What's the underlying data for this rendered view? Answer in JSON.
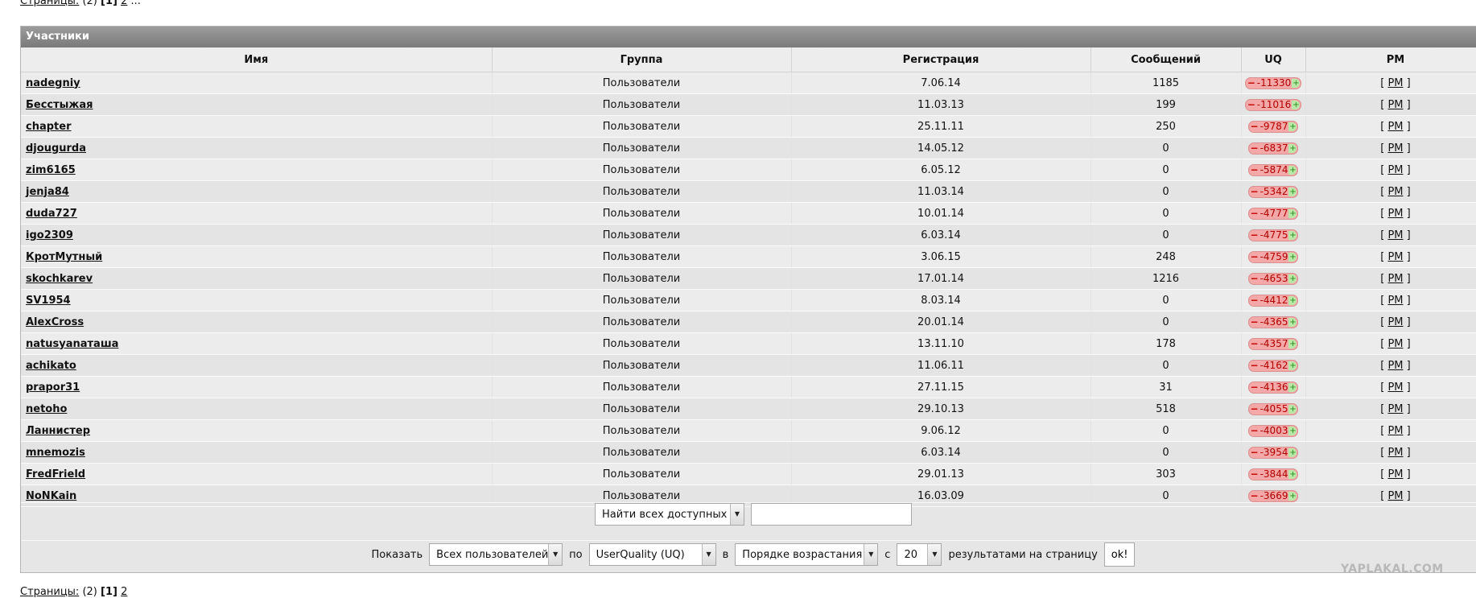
{
  "pager": {
    "label": "Страницы:",
    "total": "(2)",
    "current": "[1]",
    "next": "2",
    "more": "..."
  },
  "panel": {
    "title": "Участники"
  },
  "columns": {
    "name": "Имя",
    "group": "Группа",
    "registered": "Регистрация",
    "posts": "Сообщений",
    "uq": "UQ",
    "pm": "PM"
  },
  "uq_colors": {
    "negative_bg": "#f4a8a8",
    "plus_bg": "#b8e8a8"
  },
  "pm_label": "PM",
  "members": [
    {
      "name": "nadegniy",
      "group": "Пользователи",
      "registered": "7.06.14",
      "posts": "1185",
      "uq": "-11330"
    },
    {
      "name": "Бесстыжая",
      "group": "Пользователи",
      "registered": "11.03.13",
      "posts": "199",
      "uq": "-11016"
    },
    {
      "name": "chapter",
      "group": "Пользователи",
      "registered": "25.11.11",
      "posts": "250",
      "uq": "-9787"
    },
    {
      "name": "djougurda",
      "group": "Пользователи",
      "registered": "14.05.12",
      "posts": "0",
      "uq": "-6837"
    },
    {
      "name": "zim6165",
      "group": "Пользователи",
      "registered": "6.05.12",
      "posts": "0",
      "uq": "-5874"
    },
    {
      "name": "jenja84",
      "group": "Пользователи",
      "registered": "11.03.14",
      "posts": "0",
      "uq": "-5342"
    },
    {
      "name": "duda727",
      "group": "Пользователи",
      "registered": "10.01.14",
      "posts": "0",
      "uq": "-4777"
    },
    {
      "name": "igo2309",
      "group": "Пользователи",
      "registered": "6.03.14",
      "posts": "0",
      "uq": "-4775"
    },
    {
      "name": "КротМутный",
      "group": "Пользователи",
      "registered": "3.06.15",
      "posts": "248",
      "uq": "-4759"
    },
    {
      "name": "skochkarev",
      "group": "Пользователи",
      "registered": "17.01.14",
      "posts": "1216",
      "uq": "-4653"
    },
    {
      "name": "SV1954",
      "group": "Пользователи",
      "registered": "8.03.14",
      "posts": "0",
      "uq": "-4412"
    },
    {
      "name": "AlexCross",
      "group": "Пользователи",
      "registered": "20.01.14",
      "posts": "0",
      "uq": "-4365"
    },
    {
      "name": "natusyanаташа",
      "group": "Пользователи",
      "registered": "13.11.10",
      "posts": "178",
      "uq": "-4357"
    },
    {
      "name": "achikato",
      "group": "Пользователи",
      "registered": "11.06.11",
      "posts": "0",
      "uq": "-4162"
    },
    {
      "name": "prapor31",
      "group": "Пользователи",
      "registered": "27.11.15",
      "posts": "31",
      "uq": "-4136"
    },
    {
      "name": "netoho",
      "group": "Пользователи",
      "registered": "29.10.13",
      "posts": "518",
      "uq": "-4055"
    },
    {
      "name": "Ланнистер",
      "group": "Пользователи",
      "registered": "9.06.12",
      "posts": "0",
      "uq": "-4003"
    },
    {
      "name": "mnemozis",
      "group": "Пользователи",
      "registered": "6.03.14",
      "posts": "0",
      "uq": "-3954"
    },
    {
      "name": "FredFrield",
      "group": "Пользователи",
      "registered": "29.01.13",
      "posts": "303",
      "uq": "-3844"
    },
    {
      "name": "NoNKain",
      "group": "Пользователи",
      "registered": "16.03.09",
      "posts": "0",
      "uq": "-3669"
    }
  ],
  "search": {
    "scope_selected": "Найти всех доступных",
    "value": ""
  },
  "filters": {
    "show_label": "Показать",
    "who_selected": "Всех пользователей",
    "by_label": "по",
    "sort_selected": "UserQuality (UQ)",
    "in_label": "в",
    "order_selected": "Порядке возрастания",
    "with_label": "с",
    "count_selected": "20",
    "per_page_label": "результатами на страницу",
    "ok_label": "ok!"
  },
  "watermark": "YAPLAKAL.COM"
}
